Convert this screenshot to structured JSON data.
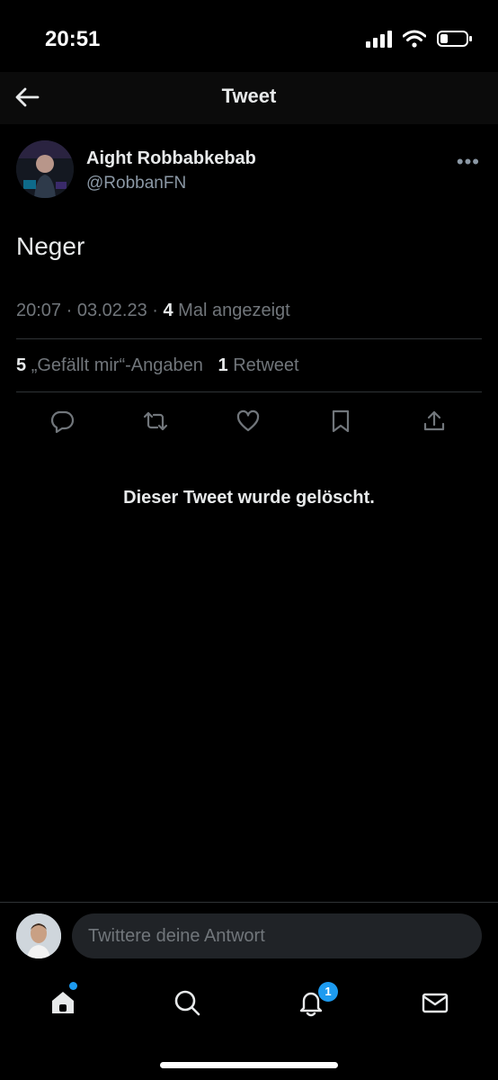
{
  "status_bar": {
    "time": "20:51"
  },
  "header": {
    "title": "Tweet"
  },
  "tweet": {
    "display_name": "Aight Robbabkebab",
    "handle": "@RobbanFN",
    "text": "Neger",
    "time": "20:07",
    "date": "03.02.23",
    "views_count": "4",
    "views_label": "Mal angezeigt",
    "likes_count": "5",
    "likes_label": "„Gefällt mir“-Angaben",
    "retweets_count": "1",
    "retweets_label": "Retweet",
    "more_label": "•••"
  },
  "deleted_notice": "Dieser Tweet wurde gelöscht.",
  "reply": {
    "placeholder": "Twittere deine Antwort"
  },
  "tabbar": {
    "notifications_badge": "1"
  },
  "icons": [
    "back-arrow-icon",
    "signal-icon",
    "wifi-icon",
    "battery-icon",
    "reply-icon",
    "retweet-icon",
    "like-icon",
    "bookmark-icon",
    "share-icon",
    "home-icon",
    "search-icon",
    "notifications-icon",
    "messages-icon"
  ],
  "colors": {
    "accent": "#1d9bf0",
    "background": "#000000",
    "secondary_text": "#71767b"
  }
}
